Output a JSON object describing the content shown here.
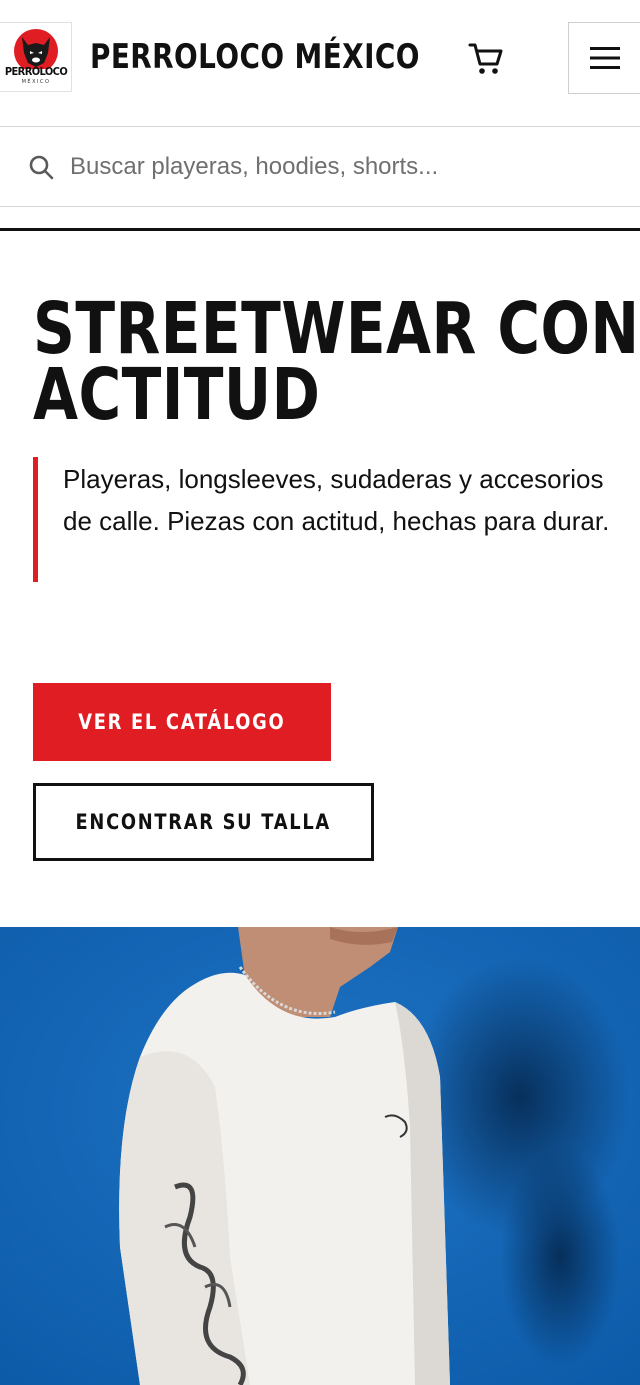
{
  "header": {
    "logo_text": "PERROLOCO",
    "logo_subtext": "MÉXICO",
    "brand_name": "PERROLOCO MÉXICO",
    "cart_icon": "cart-icon",
    "menu_icon": "hamburger-menu-icon"
  },
  "search": {
    "icon": "search-icon",
    "placeholder": "Buscar playeras, hoodies, shorts...",
    "value": ""
  },
  "hero": {
    "title_line1": "STREETWEAR CON",
    "title_line2": "ACTITUD",
    "description": "Playeras, longsleeves, sudaderas y accesorios de calle. Piezas con actitud, hechas para durar.",
    "primary_button": "VER EL CATÁLOGO",
    "secondary_button": "ENCONTRAR SU TALLA"
  },
  "colors": {
    "accent": "#e11d24",
    "text": "#111111",
    "photo_background": "#1366b8"
  }
}
